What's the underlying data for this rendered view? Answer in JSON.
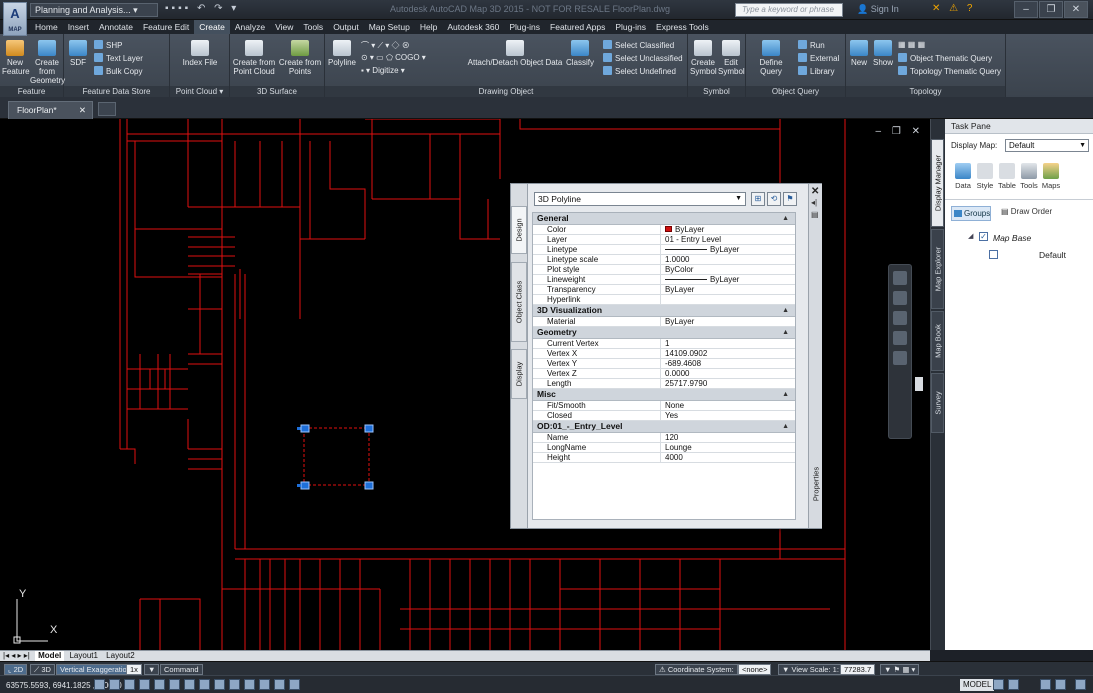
{
  "window": {
    "title": "Autodesk AutoCAD Map 3D 2015 - NOT FOR RESALE  FloorPlan.dwg",
    "workspace": "Planning and Analysis...",
    "logo_text": "MAP",
    "search_placeholder": "Type a keyword or phrase",
    "sign_in": "Sign In"
  },
  "ribbon_tabs": [
    "Home",
    "Insert",
    "Annotate",
    "Feature Edit",
    "Create",
    "Analyze",
    "View",
    "Tools",
    "Output",
    "Map Setup",
    "Help",
    "Autodesk 360",
    "Plug-ins",
    "Featured Apps",
    "Plug-ins",
    "Express Tools"
  ],
  "active_tab": "Create",
  "ribbon": {
    "feature": {
      "title": "Feature",
      "new": "New Feature",
      "create_from": "Create from Geometry"
    },
    "fds": {
      "title": "Feature Data Store",
      "sdf": "SDF",
      "shp": "SHP",
      "text_layer": "Text Layer",
      "bulk_copy": "Bulk Copy"
    },
    "pc": {
      "title": "Point Cloud",
      "index_file": "Index File"
    },
    "surf": {
      "title": "3D Surface",
      "from_pc": "Create from Point Cloud",
      "from_pts": "Create from Points"
    },
    "draw": {
      "title": "Drawing Object",
      "polyline": "Polyline",
      "cogo": "COGO",
      "digitize": "Digitize",
      "attach": "Attach/Detach Object Data",
      "classify": "Classify",
      "sel_classified": "Select Classified",
      "sel_unclassified": "Select Unclassified",
      "sel_undefined": "Select Undefined"
    },
    "sym": {
      "title": "Symbol",
      "create": "Create Symbol",
      "edit": "Edit Symbol"
    },
    "oq": {
      "title": "Object Query",
      "define": "Define Query",
      "run": "Run",
      "external": "External",
      "library": "Library"
    },
    "topo": {
      "title": "Topology",
      "new": "New",
      "show": "Show",
      "otq": "Object Thematic Query",
      "ttq": "Topology Thematic Query"
    }
  },
  "file_tab": "FloorPlan*",
  "properties": {
    "selected": "3D Polyline",
    "side_tabs": [
      "Design",
      "Object Class",
      "Display"
    ],
    "right_label": "Properties",
    "sections": [
      {
        "title": "General",
        "rows": [
          {
            "k": "Color",
            "v": "ByLayer",
            "swatch": "#d01010"
          },
          {
            "k": "Layer",
            "v": "01 - Entry Level"
          },
          {
            "k": "Linetype",
            "v": "ByLayer",
            "line": true
          },
          {
            "k": "Linetype scale",
            "v": "1.0000"
          },
          {
            "k": "Plot style",
            "v": "ByColor"
          },
          {
            "k": "Lineweight",
            "v": "ByLayer",
            "line": true
          },
          {
            "k": "Transparency",
            "v": "ByLayer"
          },
          {
            "k": "Hyperlink",
            "v": ""
          }
        ]
      },
      {
        "title": "3D Visualization",
        "rows": [
          {
            "k": "Material",
            "v": "ByLayer"
          }
        ]
      },
      {
        "title": "Geometry",
        "rows": [
          {
            "k": "Current Vertex",
            "v": "1"
          },
          {
            "k": "Vertex X",
            "v": "14109.0902"
          },
          {
            "k": "Vertex Y",
            "v": "-689.4608"
          },
          {
            "k": "Vertex Z",
            "v": "0.0000"
          },
          {
            "k": "Length",
            "v": "25717.9790"
          }
        ]
      },
      {
        "title": "Misc",
        "rows": [
          {
            "k": "Fit/Smooth",
            "v": "None"
          },
          {
            "k": "Closed",
            "v": "Yes"
          }
        ]
      },
      {
        "title": "OD:01_-_Entry_Level",
        "rows": [
          {
            "k": "Name",
            "v": "120"
          },
          {
            "k": "LongName",
            "v": "Lounge"
          },
          {
            "k": "Height",
            "v": "4000"
          }
        ]
      }
    ]
  },
  "task_pane": {
    "title": "Task Pane",
    "display_map_label": "Display Map:",
    "display_map_value": "Default",
    "side_tabs": [
      "Display Manager",
      "Map Explorer",
      "Map Book",
      "Survey"
    ],
    "tools": [
      "Data",
      "Style",
      "Table",
      "Tools",
      "Maps"
    ],
    "groups": "Groups",
    "draw_order": "Draw Order",
    "map_base": "Map Base",
    "default_layer": "Default"
  },
  "layout_tabs": [
    "Model",
    "Layout1",
    "Layout2"
  ],
  "command_bar": {
    "mode_2d": "2D",
    "mode_3d": "3D",
    "vert_exag": "Vertical Exaggeration:",
    "vert_val": "1x",
    "command": "Command",
    "coord_label": "Coordinate System:",
    "coord_val": "<none>",
    "scale_label": "View Scale: 1:",
    "scale_val": "77283.7"
  },
  "status": {
    "coords": "63575.5593, 6941.1825 , 0.0000",
    "model": "MODEL"
  },
  "ucs": {
    "x": "X",
    "y": "Y"
  },
  "colors": {
    "cad_red": "#e01010",
    "accent": "#3b86c7",
    "grip": "#1e6fd9"
  }
}
